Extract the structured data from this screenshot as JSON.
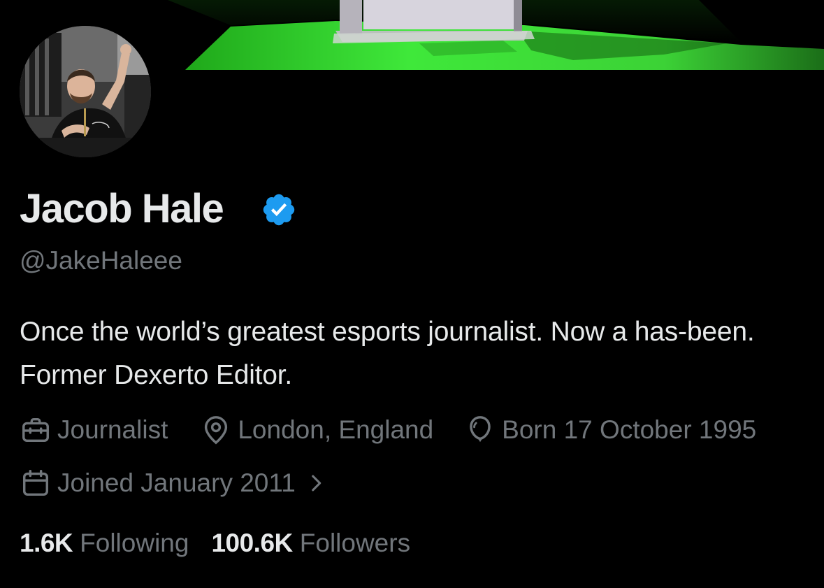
{
  "banner": {
    "accent_color": "#3fe83a"
  },
  "profile": {
    "display_name": "Jacob Hale",
    "verified": true,
    "verified_color": "#1d9bf0",
    "handle": "@JakeHaleee",
    "bio": "Once the world’s greatest esports journalist. Now a has-been. Former Dexerto Editor."
  },
  "meta": {
    "profession": "Journalist",
    "location": "London, England",
    "birthday": "Born 17 October 1995",
    "joined": "Joined January 2011",
    "icons": [
      "briefcase-icon",
      "location-pin-icon",
      "balloon-icon",
      "calendar-icon",
      "chevron-right-icon"
    ]
  },
  "stats": {
    "following_count": "1.6K",
    "following_label": "Following",
    "followers_count": "100.6K",
    "followers_label": "Followers"
  },
  "colors": {
    "background": "#000000",
    "primary_text": "#e7e9ea",
    "secondary_text": "#71767b"
  }
}
